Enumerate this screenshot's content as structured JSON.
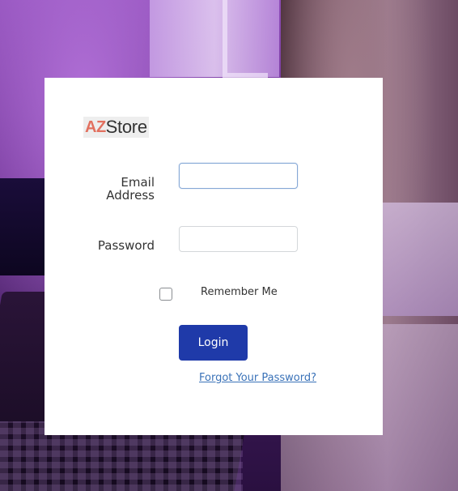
{
  "logo": {
    "prefix": "AZ",
    "suffix": "Store",
    "prefix_color": "#e2705f"
  },
  "form": {
    "email_label": "Email Address",
    "email_value": "",
    "password_label": "Password",
    "password_value": "",
    "remember_label": "Remember Me",
    "remember_checked": false,
    "login_label": "Login",
    "forgot_label": "Forgot Your Password?"
  },
  "colors": {
    "primary_button": "#1f3aa9",
    "link": "#3a72b8",
    "focus_border": "#86a8d6"
  }
}
